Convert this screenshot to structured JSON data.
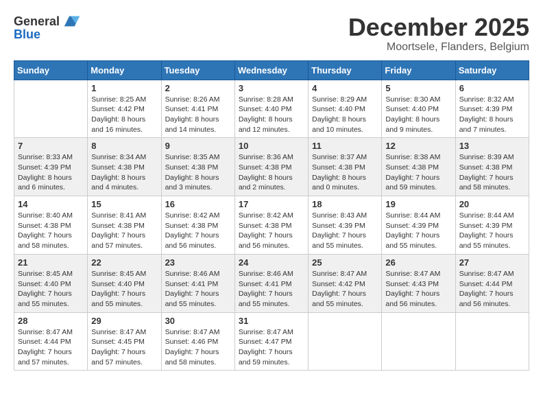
{
  "header": {
    "logo_general": "General",
    "logo_blue": "Blue",
    "month_title": "December 2025",
    "location": "Moortsele, Flanders, Belgium"
  },
  "days_of_week": [
    "Sunday",
    "Monday",
    "Tuesday",
    "Wednesday",
    "Thursday",
    "Friday",
    "Saturday"
  ],
  "weeks": [
    [
      {
        "day": "",
        "info": ""
      },
      {
        "day": "1",
        "info": "Sunrise: 8:25 AM\nSunset: 4:42 PM\nDaylight: 8 hours\nand 16 minutes."
      },
      {
        "day": "2",
        "info": "Sunrise: 8:26 AM\nSunset: 4:41 PM\nDaylight: 8 hours\nand 14 minutes."
      },
      {
        "day": "3",
        "info": "Sunrise: 8:28 AM\nSunset: 4:40 PM\nDaylight: 8 hours\nand 12 minutes."
      },
      {
        "day": "4",
        "info": "Sunrise: 8:29 AM\nSunset: 4:40 PM\nDaylight: 8 hours\nand 10 minutes."
      },
      {
        "day": "5",
        "info": "Sunrise: 8:30 AM\nSunset: 4:40 PM\nDaylight: 8 hours\nand 9 minutes."
      },
      {
        "day": "6",
        "info": "Sunrise: 8:32 AM\nSunset: 4:39 PM\nDaylight: 8 hours\nand 7 minutes."
      }
    ],
    [
      {
        "day": "7",
        "info": "Sunrise: 8:33 AM\nSunset: 4:39 PM\nDaylight: 8 hours\nand 6 minutes."
      },
      {
        "day": "8",
        "info": "Sunrise: 8:34 AM\nSunset: 4:38 PM\nDaylight: 8 hours\nand 4 minutes."
      },
      {
        "day": "9",
        "info": "Sunrise: 8:35 AM\nSunset: 4:38 PM\nDaylight: 8 hours\nand 3 minutes."
      },
      {
        "day": "10",
        "info": "Sunrise: 8:36 AM\nSunset: 4:38 PM\nDaylight: 8 hours\nand 2 minutes."
      },
      {
        "day": "11",
        "info": "Sunrise: 8:37 AM\nSunset: 4:38 PM\nDaylight: 8 hours\nand 0 minutes."
      },
      {
        "day": "12",
        "info": "Sunrise: 8:38 AM\nSunset: 4:38 PM\nDaylight: 7 hours\nand 59 minutes."
      },
      {
        "day": "13",
        "info": "Sunrise: 8:39 AM\nSunset: 4:38 PM\nDaylight: 7 hours\nand 58 minutes."
      }
    ],
    [
      {
        "day": "14",
        "info": "Sunrise: 8:40 AM\nSunset: 4:38 PM\nDaylight: 7 hours\nand 58 minutes."
      },
      {
        "day": "15",
        "info": "Sunrise: 8:41 AM\nSunset: 4:38 PM\nDaylight: 7 hours\nand 57 minutes."
      },
      {
        "day": "16",
        "info": "Sunrise: 8:42 AM\nSunset: 4:38 PM\nDaylight: 7 hours\nand 56 minutes."
      },
      {
        "day": "17",
        "info": "Sunrise: 8:42 AM\nSunset: 4:38 PM\nDaylight: 7 hours\nand 56 minutes."
      },
      {
        "day": "18",
        "info": "Sunrise: 8:43 AM\nSunset: 4:39 PM\nDaylight: 7 hours\nand 55 minutes."
      },
      {
        "day": "19",
        "info": "Sunrise: 8:44 AM\nSunset: 4:39 PM\nDaylight: 7 hours\nand 55 minutes."
      },
      {
        "day": "20",
        "info": "Sunrise: 8:44 AM\nSunset: 4:39 PM\nDaylight: 7 hours\nand 55 minutes."
      }
    ],
    [
      {
        "day": "21",
        "info": "Sunrise: 8:45 AM\nSunset: 4:40 PM\nDaylight: 7 hours\nand 55 minutes."
      },
      {
        "day": "22",
        "info": "Sunrise: 8:45 AM\nSunset: 4:40 PM\nDaylight: 7 hours\nand 55 minutes."
      },
      {
        "day": "23",
        "info": "Sunrise: 8:46 AM\nSunset: 4:41 PM\nDaylight: 7 hours\nand 55 minutes."
      },
      {
        "day": "24",
        "info": "Sunrise: 8:46 AM\nSunset: 4:41 PM\nDaylight: 7 hours\nand 55 minutes."
      },
      {
        "day": "25",
        "info": "Sunrise: 8:47 AM\nSunset: 4:42 PM\nDaylight: 7 hours\nand 55 minutes."
      },
      {
        "day": "26",
        "info": "Sunrise: 8:47 AM\nSunset: 4:43 PM\nDaylight: 7 hours\nand 56 minutes."
      },
      {
        "day": "27",
        "info": "Sunrise: 8:47 AM\nSunset: 4:44 PM\nDaylight: 7 hours\nand 56 minutes."
      }
    ],
    [
      {
        "day": "28",
        "info": "Sunrise: 8:47 AM\nSunset: 4:44 PM\nDaylight: 7 hours\nand 57 minutes."
      },
      {
        "day": "29",
        "info": "Sunrise: 8:47 AM\nSunset: 4:45 PM\nDaylight: 7 hours\nand 57 minutes."
      },
      {
        "day": "30",
        "info": "Sunrise: 8:47 AM\nSunset: 4:46 PM\nDaylight: 7 hours\nand 58 minutes."
      },
      {
        "day": "31",
        "info": "Sunrise: 8:47 AM\nSunset: 4:47 PM\nDaylight: 7 hours\nand 59 minutes."
      },
      {
        "day": "",
        "info": ""
      },
      {
        "day": "",
        "info": ""
      },
      {
        "day": "",
        "info": ""
      }
    ]
  ]
}
